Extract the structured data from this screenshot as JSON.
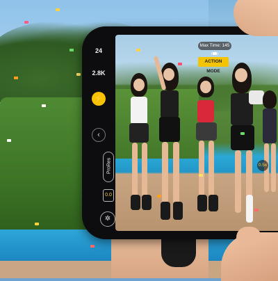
{
  "camera_ui": {
    "frame_rate": "24",
    "resolution": "2.8K",
    "flash_symbol": "⚡",
    "back_chevron": "‹",
    "prores_label": "ProRes",
    "lens_value": "0.0",
    "exposure_label": "Max Time: 145 min",
    "mode_badge": "ACTION MODE",
    "zoom_level": "0.5x"
  },
  "colors": {
    "mode_badge": "#f5c400",
    "flash_button": "#f7c300",
    "phone_body": "#0d0d0f"
  },
  "icons": {
    "flash": "flash-icon",
    "chevron": "chevron-left-icon",
    "lens": "lens-icon",
    "shutter": "shutter-settings-icon"
  }
}
